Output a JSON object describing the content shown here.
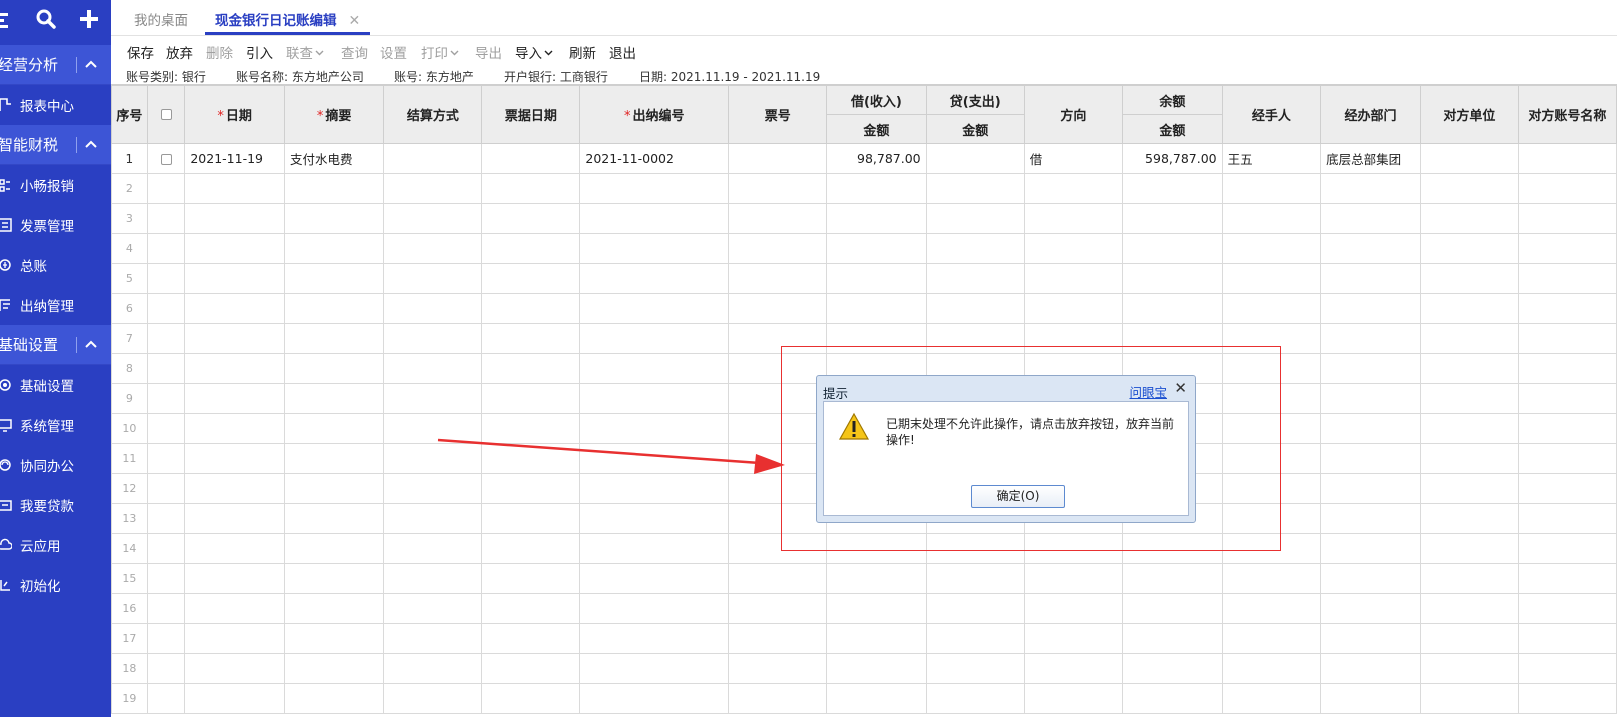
{
  "sidebar": {
    "top_icons": [
      "list-icon",
      "search-icon",
      "plus-icon"
    ],
    "sections": [
      {
        "label": "经营分析",
        "items": [
          {
            "label": "报表中心",
            "icon": "report-icon"
          }
        ]
      },
      {
        "label": "智能财税",
        "items": [
          {
            "label": "小畅报销",
            "icon": "reimburse-icon"
          },
          {
            "label": "发票管理",
            "icon": "invoice-icon"
          },
          {
            "label": "总账",
            "icon": "ledger-icon"
          },
          {
            "label": "出纳管理",
            "icon": "cashier-icon"
          }
        ]
      },
      {
        "label": "基础设置",
        "items": [
          {
            "label": "基础设置",
            "icon": "basic-settings-icon"
          },
          {
            "label": "系统管理",
            "icon": "system-icon"
          },
          {
            "label": "协同办公",
            "icon": "collab-icon"
          },
          {
            "label": "我要贷款",
            "icon": "loan-icon"
          },
          {
            "label": "云应用",
            "icon": "cloud-icon"
          },
          {
            "label": "初始化",
            "icon": "init-icon"
          }
        ]
      }
    ]
  },
  "tabs": [
    {
      "label": "我的桌面",
      "active": false
    },
    {
      "label": "现金银行日记账编辑",
      "active": true,
      "close": "✕"
    }
  ],
  "toolbar": {
    "save": "保存",
    "discard": "放弃",
    "delete": "删除",
    "import_in": "引入",
    "linked_query": "联查",
    "query": "查询",
    "settings": "设置",
    "print": "打印",
    "export": "导出",
    "import": "导入",
    "refresh": "刷新",
    "exit": "退出"
  },
  "info": {
    "account_type": "账号类别: 银行",
    "account_name": "账号名称: 东方地产公司",
    "account_no": "账号: 东方地产",
    "bank": "开户银行: 工商银行",
    "date": "日期:  2021.11.19 - 2021.11.19"
  },
  "grid": {
    "headers": {
      "seq": "序号",
      "date": "日期",
      "summary": "摘要",
      "settle": "结算方式",
      "bill_date": "票据日期",
      "cashier_no": "出纳编号",
      "bill_no": "票号",
      "debit": "借(收入)",
      "credit": "贷(支出)",
      "direction": "方向",
      "balance": "余额",
      "amount": "金额",
      "handler": "经手人",
      "dept": "经办部门",
      "counterparty": "对方单位",
      "counter_account": "对方账号名称"
    },
    "rows": [
      {
        "seq": "1",
        "date": "2021-11-19",
        "summary": "支付水电费",
        "settle": "",
        "bill_date": "",
        "cashier_no": "2021-11-0002",
        "bill_no": "",
        "debit": "98,787.00",
        "credit": "",
        "direction": "借",
        "balance": "598,787.00",
        "handler": "王五",
        "dept": "底层总部集团",
        "counterparty": "",
        "counter_account": ""
      }
    ],
    "empty_seq": [
      "2",
      "3",
      "4",
      "5",
      "6",
      "7",
      "8",
      "9",
      "10",
      "11",
      "12",
      "13",
      "14",
      "15",
      "16",
      "17",
      "18",
      "19"
    ]
  },
  "dialog": {
    "title": "提示",
    "help_link": "问眼宝",
    "close": "✕",
    "message": "已期末处理不允许此操作，请点击放弃按钮，放弃当前操作!",
    "ok_label": "确定(O)",
    "icon": "warning-icon"
  },
  "colors": {
    "sidebar": "#2a3fc2",
    "sidebar_group": "#3d55d6",
    "accent": "#2a3fc2",
    "annotation": "#e83030"
  }
}
